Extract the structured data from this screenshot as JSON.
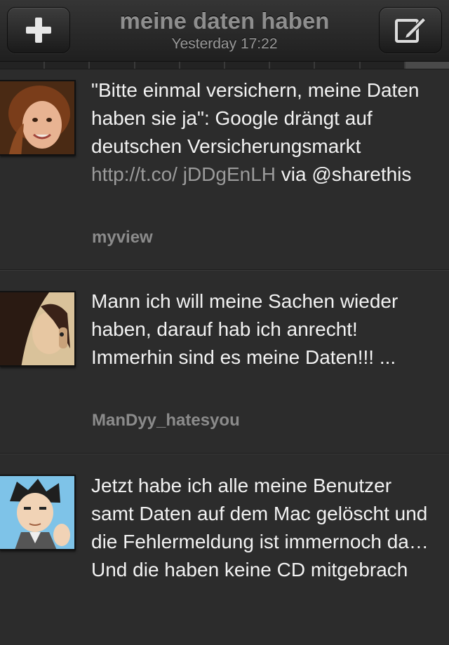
{
  "header": {
    "title": "meine daten haben",
    "subtitle": "Yesterday 17:22",
    "add_icon": "plus-icon",
    "compose_icon": "compose-icon"
  },
  "tabs": {
    "count": 10,
    "active_index": 9
  },
  "tweets": [
    {
      "text_before": "\"Bitte einmal versichern, meine Daten haben sie ja\": Google drängt auf deutschen Versicherungsmarkt ",
      "link": "http://t.co/ jDDgEnLH",
      "text_after": " via @sharethis",
      "user": "myview"
    },
    {
      "text_before": "Mann ich will meine Sachen wieder haben, darauf hab ich anrecht! Immerhin sind es meine Daten!!! ...",
      "link": "",
      "text_after": "",
      "user": "ManDyy_hatesyou"
    },
    {
      "text_before": "Jetzt habe ich alle meine Benutzer samt Daten auf dem Mac gelöscht und die Fehlermeldung ist immernoch da… Und die haben keine CD mitgebrach",
      "link": "",
      "text_after": "",
      "user": ""
    }
  ],
  "colors": {
    "background": "#2c2c2c",
    "tweet_text": "#f2f2f2",
    "link_text": "#9b9b9b",
    "username_text": "#8b8b8b"
  }
}
